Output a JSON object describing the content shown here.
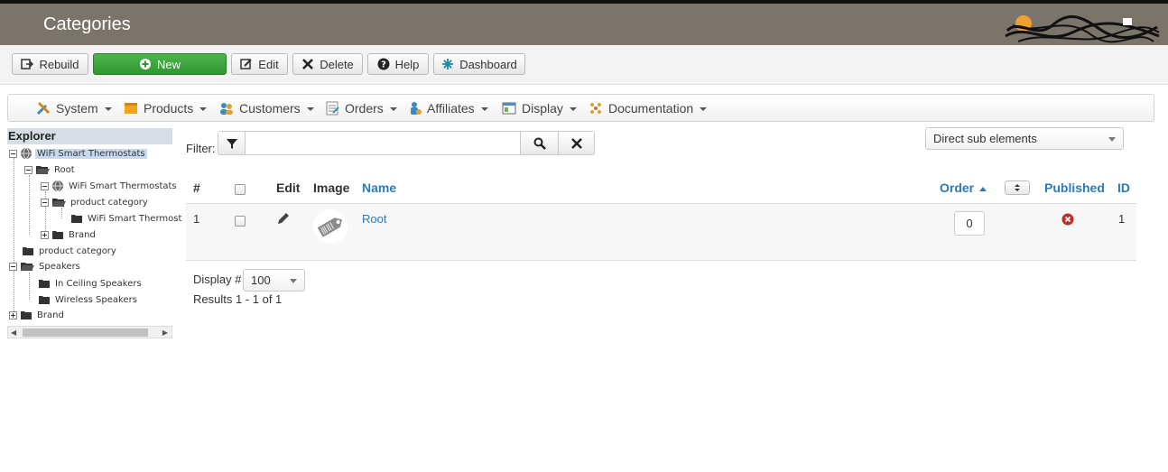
{
  "header": {
    "title": "Categories"
  },
  "toolbar": {
    "rebuild": "Rebuild",
    "new": "New",
    "edit": "Edit",
    "delete": "Delete",
    "help": "Help",
    "dashboard": "Dashboard"
  },
  "menu": {
    "system": "System",
    "products": "Products",
    "customers": "Customers",
    "orders": "Orders",
    "affiliates": "Affiliates",
    "display": "Display",
    "documentation": "Documentation"
  },
  "explorer": {
    "title": "Explorer",
    "nodes": [
      "WiFi Smart Thermostats",
      "Root",
      "WiFi Smart Thermostats",
      "product category",
      "WiFi Smart Thermost",
      "Brand",
      "product category",
      "Speakers",
      "In Ceiling Speakers",
      "Wireless Speakers",
      "Brand"
    ]
  },
  "filter": {
    "label": "Filter:",
    "value": ""
  },
  "scope_select": {
    "selected": "Direct sub elements"
  },
  "table": {
    "headers": {
      "num": "#",
      "edit": "Edit",
      "image": "Image",
      "name": "Name",
      "order": "Order",
      "published": "Published",
      "id": "ID"
    },
    "rows": [
      {
        "num": "1",
        "name": "Root",
        "order": "0",
        "published": false,
        "id": "1"
      }
    ]
  },
  "footer": {
    "display_label": "Display #",
    "display_value": "100",
    "results": "Results 1 - 1 of 1"
  },
  "colors": {
    "header_bg": "#7a746b",
    "link": "#2a7ab8",
    "new_button": "#3aa53a",
    "unpublished": "#c0302b"
  }
}
